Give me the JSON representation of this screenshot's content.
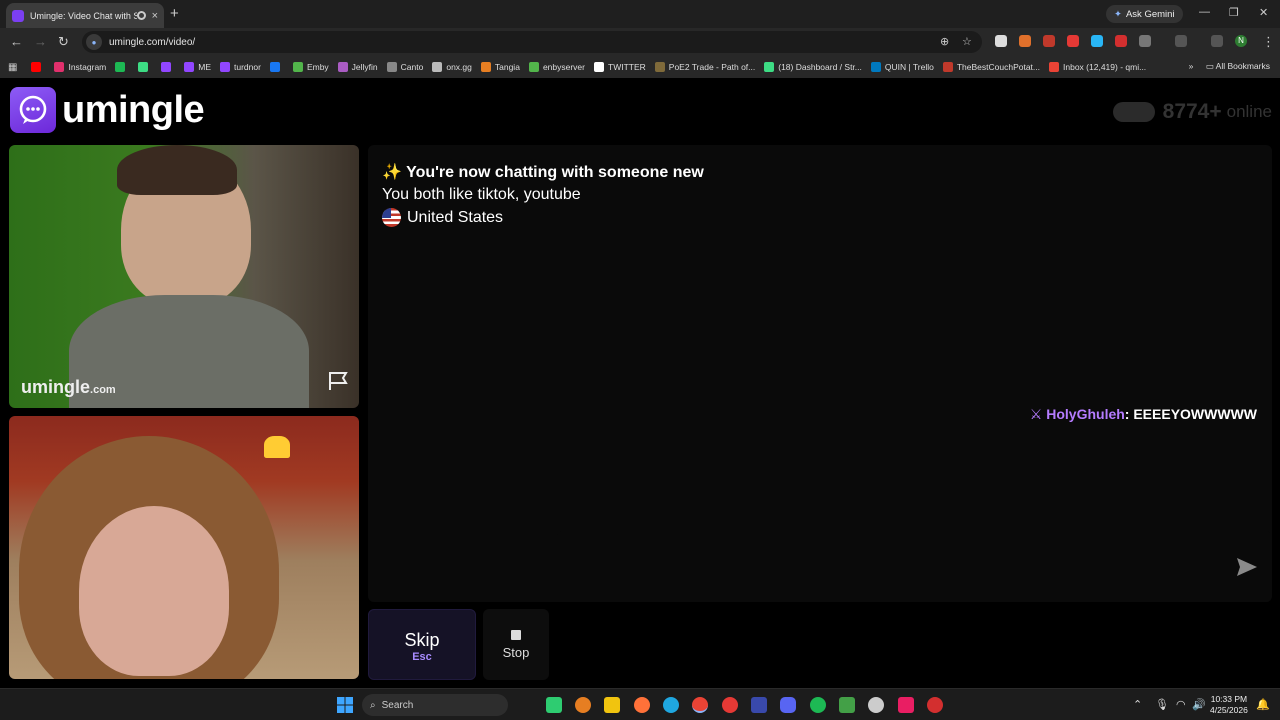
{
  "browser": {
    "tab_title": "Umingle: Video Chat with S",
    "tab_close": "×",
    "new_tab": "+",
    "ask_gemini": "Ask Gemini",
    "url": "umingle.com/video/",
    "profile_initial": "N"
  },
  "bookmarks": [
    {
      "label": "",
      "color": "#ff0000"
    },
    {
      "label": "Instagram",
      "color": "#e1306c"
    },
    {
      "label": "",
      "color": "#1db954"
    },
    {
      "label": "",
      "color": "#3ddc84"
    },
    {
      "label": "",
      "color": "#9146ff"
    },
    {
      "label": "ME",
      "color": "#9146ff"
    },
    {
      "label": "turdnor",
      "color": "#9146ff"
    },
    {
      "label": "",
      "color": "#1877f2"
    },
    {
      "label": "Emby",
      "color": "#52b54b"
    },
    {
      "label": "Jellyfin",
      "color": "#aa5cc3"
    },
    {
      "label": "Canto",
      "color": "#888888"
    },
    {
      "label": "onx.gg",
      "color": "#bbbbbb"
    },
    {
      "label": "Tangia",
      "color": "#e67e22"
    },
    {
      "label": "enbyserver",
      "color": "#52b54b"
    },
    {
      "label": "TWITTER",
      "color": "#ffffff"
    },
    {
      "label": "PoE2 Trade - Path of...",
      "color": "#7f6a3a"
    },
    {
      "label": "(18) Dashboard / Str...",
      "color": "#3ddc84"
    },
    {
      "label": "QUIN | Trello",
      "color": "#0079bf"
    },
    {
      "label": "TheBestCouchPotat...",
      "color": "#c0392b"
    },
    {
      "label": "Inbox (12,419) - qmi...",
      "color": "#ea4335"
    }
  ],
  "all_bookmarks": "All Bookmarks",
  "site": {
    "logo_text": "umingle",
    "online_count": "8774+",
    "online_label": "online"
  },
  "video": {
    "watermark": "umingle",
    "watermark_suffix": ".com"
  },
  "chat": {
    "header": "You're now chatting with someone new",
    "header_emoji": "✨",
    "likes": "You both like tiktok, youtube",
    "country": "United States",
    "message_author": "HolyGhuleh",
    "message_text": ": EEEEYOWWWWW"
  },
  "controls": {
    "skip_label": "Skip",
    "skip_key": "Esc",
    "stop_label": "Stop"
  },
  "taskbar": {
    "search_label": "Search",
    "time": "10:33 PM",
    "date": "4/25/2026"
  }
}
